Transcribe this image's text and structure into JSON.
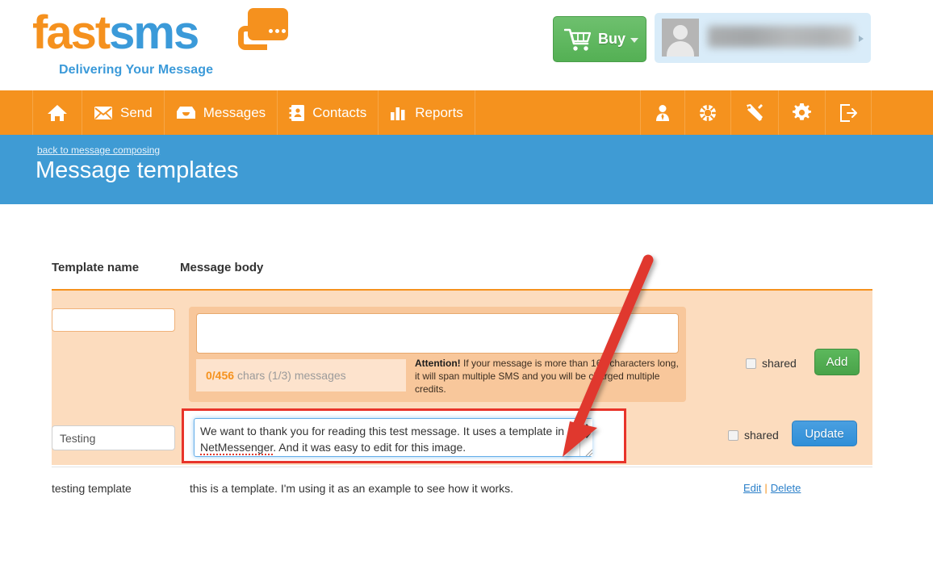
{
  "brand": {
    "name_part1": "fast",
    "name_part2": "sms",
    "tagline": "Delivering Your Message",
    "orange": "#f5921e",
    "blue": "#3b9ad9"
  },
  "topbar": {
    "buy_label": "Buy",
    "buy_icon": "shopping-cart-icon",
    "buy_caret_icon": "caret-down-icon",
    "user_name_masked": "",
    "avatar_icon": "user-avatar-icon",
    "user_caret_icon": "caret-right-icon"
  },
  "nav": {
    "left_items": [
      {
        "label": "",
        "icon": "home-icon"
      },
      {
        "label": "Send",
        "icon": "envelope-icon"
      },
      {
        "label": "Messages",
        "icon": "inbox-icon"
      },
      {
        "label": "Contacts",
        "icon": "address-card-icon"
      },
      {
        "label": "Reports",
        "icon": "bar-chart-icon"
      }
    ],
    "right_items": [
      {
        "label": "",
        "icon": "user-tie-icon"
      },
      {
        "label": "",
        "icon": "life-ring-icon"
      },
      {
        "label": "",
        "icon": "tools-icon"
      },
      {
        "label": "",
        "icon": "gear-icon"
      },
      {
        "label": "",
        "icon": "logout-icon"
      }
    ]
  },
  "banner": {
    "back_link": "back to message composing",
    "title": "Message templates",
    "background": "#3f9bd4"
  },
  "table": {
    "headers": {
      "name": "Template name",
      "body": "Message body"
    }
  },
  "add_form": {
    "name_value": "",
    "body_value": "",
    "counter_count": "0/456",
    "counter_rest": "chars (1/3) messages",
    "attention_bold": "Attention!",
    "attention_text": " If your message is more than 160 characters long, it will span multiple SMS and you will be charged multiple credits.",
    "shared_label": "shared",
    "shared_checked": false,
    "submit_label": "Add",
    "submit_color": "#4fae4f",
    "panel_color": "#fcdcbe"
  },
  "edit_form": {
    "name_value": "Testing",
    "body_line1": "We want to thank you for reading this test message. It uses a template in",
    "body_line2_spell": "NetMessenger",
    "body_line2_rest": ". And it was easy to edit for this image.",
    "shared_label": "shared",
    "shared_checked": false,
    "submit_label": "Update",
    "submit_color": "#2f8fd8",
    "highlight_color": "#e8342a"
  },
  "list_rows": [
    {
      "name": "testing template",
      "body": "this is a template. I'm using it as an example to see how it works.",
      "edit_label": "Edit",
      "separator": "|",
      "delete_label": "Delete"
    }
  ],
  "annotation": {
    "arrow_color": "#e03a2f",
    "arrow_icon": "red-arrow-annotation"
  }
}
